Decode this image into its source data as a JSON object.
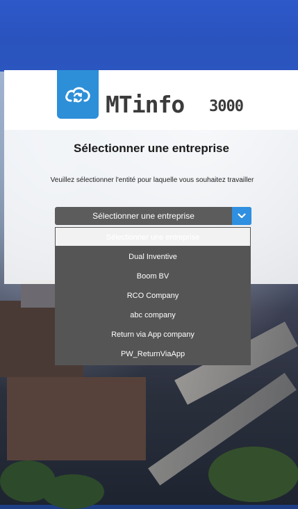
{
  "header": {
    "brand_name": "MTinfo",
    "brand_number": "3000"
  },
  "main": {
    "title": "Sélectionner une entreprise",
    "description": "Veuillez sélectionner l'entité pour laquelle vous souhaitez travailler"
  },
  "company_select": {
    "selected_label": "Sélectionner une entreprise",
    "options": [
      "Sélectionner une entreprise",
      "Dual Inventive",
      "Boom BV",
      "RCO Company",
      "abc company",
      "Return via App company",
      "PW_ReturnViaApp"
    ]
  },
  "colors": {
    "accent": "#2f8fe0",
    "logo_blue": "#2d8fd8",
    "select_bg": "#5c5c5c",
    "dropdown_bg": "#555555"
  },
  "icons": {
    "logo": "cloud-sync-icon",
    "select_arrow": "chevron-down-icon"
  }
}
